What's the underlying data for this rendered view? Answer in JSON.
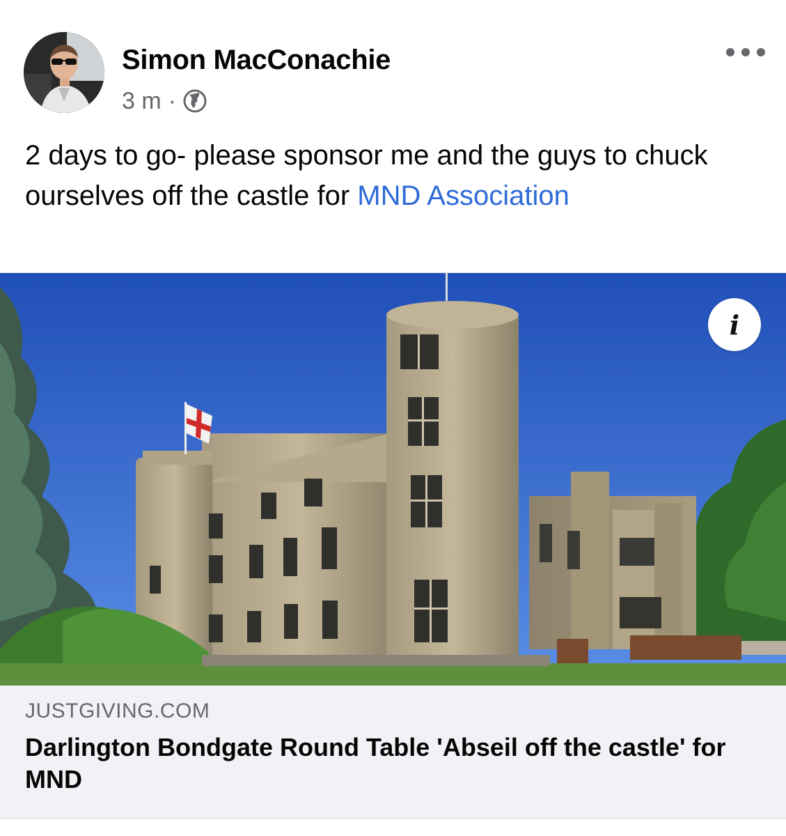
{
  "post": {
    "author_name": "Simon MacConachie",
    "time": "3 m",
    "separator": "·",
    "privacy_icon": "globe-icon",
    "more_icon": "more-horizontal-icon",
    "text": "2 days to go- please sponsor me and the guys to chuck ourselves off the castle for ",
    "tagged_page": "MND Association",
    "link_color": "#2e6bd8"
  },
  "link_preview": {
    "info_label": "i",
    "domain": "JUSTGIVING.COM",
    "title": "Darlington Bondgate Round Table 'Abseil off the castle' for MND"
  }
}
